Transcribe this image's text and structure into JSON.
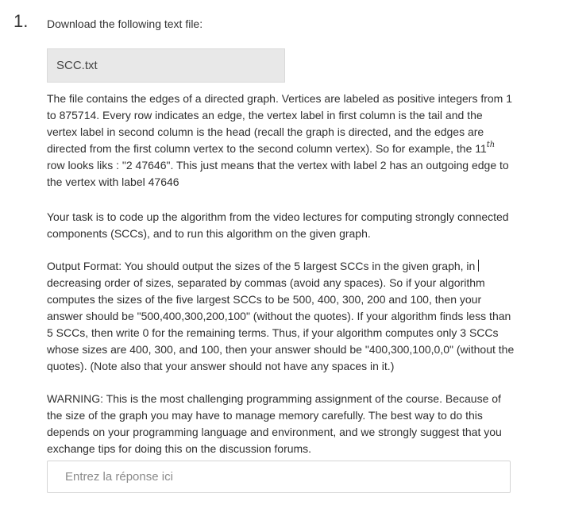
{
  "question": {
    "number": "1.",
    "intro": "Download the following text file:",
    "file_name": "SCC.txt",
    "paragraph1": {
      "part1": "The file contains the edges of a directed graph. Vertices are labeled as positive integers from 1 to 875714. Every row indicates an edge, the vertex label in first column is the tail and the vertex label in second column is the head (recall the graph is directed, and the edges are directed from the first column vertex to the second column vertex). So for example, the 11",
      "superscript": "th",
      "part2": " row looks liks : \"2 47646\". This just means that the vertex with label 2 has an outgoing edge to the vertex with label 47646"
    },
    "paragraph2": "Your task is to code up the algorithm from the video lectures for computing strongly connected components (SCCs), and to run this algorithm on the given graph.",
    "paragraph3": {
      "part1": "Output Format: You should output the sizes of the 5 largest SCCs in the given graph, in ",
      "part2": "decreasing order of sizes, separated by commas (avoid any spaces). So if your algorithm computes the sizes of the five largest SCCs to be 500, 400, 300, 200 and 100, then your answer should be \"500,400,300,200,100\" (without the quotes). If your algorithm finds less than 5 SCCs, then write 0 for the remaining terms. Thus, if your algorithm computes only 3 SCCs whose sizes are 400, 300, and 100, then your answer should be \"400,300,100,0,0\" (without the quotes). (Note also that your answer should not have any spaces in it.)"
    },
    "paragraph4": "WARNING: This is the most challenging programming assignment of the course. Because of the size of the graph you may have to manage memory carefully. The best way to do this depends on your programming language and environment, and we strongly suggest that you exchange tips for doing this on the discussion forums.",
    "answer": {
      "value": "",
      "placeholder": "Entrez la réponse ici"
    }
  }
}
